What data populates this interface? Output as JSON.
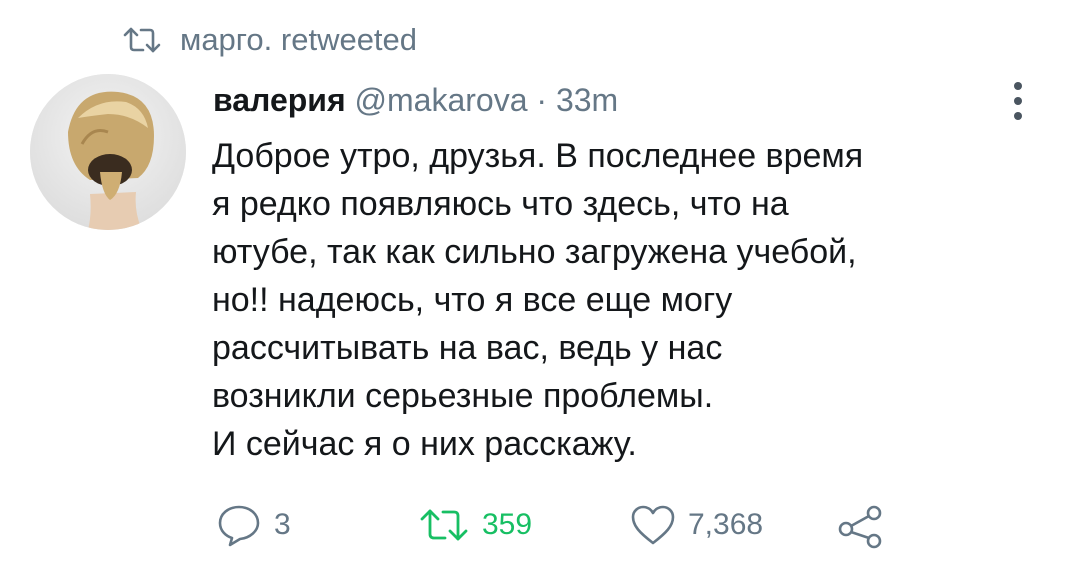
{
  "retweet_header": {
    "text": "марго. retweeted",
    "icon": "retweet-icon"
  },
  "tweet": {
    "author_name": "валерия",
    "handle": "@makarova",
    "separator": "·",
    "time": "33m",
    "text_lines": [
      "Доброе утро, друзья. В последнее время",
      "я редко появляюсь что здесь, что на",
      "ютубе, так как сильно загружена учебой,",
      "но!! надеюсь, что я все еще могу",
      "рассчитывать на вас, ведь у нас",
      "возникли серьезные проблемы.",
      "И сейчас я о них расскажу."
    ]
  },
  "actions": {
    "replies": "3",
    "retweets": "359",
    "likes": "7,368"
  },
  "colors": {
    "muted": "#657786",
    "retweet_active": "#17bf63",
    "text": "#14171a"
  }
}
